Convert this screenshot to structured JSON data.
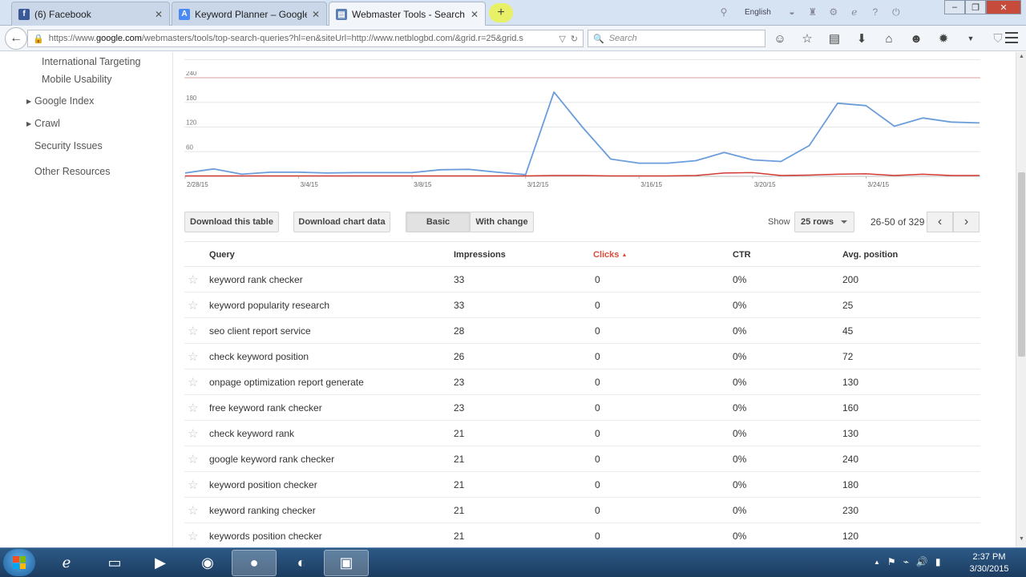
{
  "browser": {
    "tabs": [
      {
        "title": "(6) Facebook",
        "icon": "facebook-icon",
        "color": "#3b5998",
        "glyph": "f"
      },
      {
        "title": "Keyword Planner – Google ...",
        "icon": "google-adwords-icon",
        "color": "#4a8af4",
        "glyph": "A"
      },
      {
        "title": "Webmaster Tools - Search ...",
        "icon": "webmaster-tools-icon",
        "color": "#5b7fb5",
        "glyph": "▤"
      }
    ],
    "newtab_glyph": "+",
    "language": "English",
    "url_prefix": "https://www.",
    "url_domain": "google.com",
    "url_rest": "/webmasters/tools/top-search-queries?hl=en&siteUrl=http://www.netblogbd.com/&grid.r=25&grid.s",
    "search_placeholder": "Search"
  },
  "sidebar": {
    "sub_items": [
      "International Targeting",
      "Mobile Usability"
    ],
    "sections": [
      {
        "label": "Google Index",
        "expandable": true
      },
      {
        "label": "Crawl",
        "expandable": true
      },
      {
        "label": "Security Issues",
        "expandable": false
      },
      {
        "label": "Other Resources",
        "expandable": false
      }
    ]
  },
  "chart_data": {
    "type": "line",
    "title": "",
    "xlabel": "",
    "ylabel": "",
    "ylim": [
      0,
      240
    ],
    "yticks": [
      60,
      120,
      180,
      240
    ],
    "x": [
      "2/28/15",
      "3/1/15",
      "3/2/15",
      "3/3/15",
      "3/4/15",
      "3/5/15",
      "3/6/15",
      "3/7/15",
      "3/8/15",
      "3/9/15",
      "3/10/15",
      "3/11/15",
      "3/12/15",
      "3/13/15",
      "3/14/15",
      "3/15/15",
      "3/16/15",
      "3/17/15",
      "3/18/15",
      "3/19/15",
      "3/20/15",
      "3/21/15",
      "3/22/15",
      "3/23/15",
      "3/24/15",
      "3/25/15",
      "3/26/15",
      "3/27/15",
      "3/28/15"
    ],
    "xtick_labels": [
      "2/28/15",
      "3/4/15",
      "3/8/15",
      "3/12/15",
      "3/16/15",
      "3/20/15",
      "3/24/15"
    ],
    "series": [
      {
        "name": "Impressions",
        "color": "#6b9ddb",
        "values": [
          8,
          18,
          5,
          10,
          10,
          8,
          9,
          9,
          9,
          16,
          17,
          10,
          4,
          205,
          120,
          42,
          32,
          32,
          38,
          58,
          40,
          36,
          75,
          178,
          172,
          122,
          142,
          132,
          130
        ]
      },
      {
        "name": "Clicks",
        "color": "#d33a32",
        "values": [
          1,
          1,
          1,
          1,
          1,
          1,
          1,
          1,
          1,
          1,
          1,
          1,
          1,
          2,
          2,
          1,
          1,
          1,
          2,
          8,
          9,
          2,
          3,
          5,
          6,
          2,
          5,
          2,
          2
        ]
      }
    ]
  },
  "controls": {
    "download_table": "Download this table",
    "download_chart": "Download chart data",
    "view_basic": "Basic",
    "view_change": "With change",
    "show_label": "Show",
    "rows_value": "25 rows",
    "range_text": "26-50 of 329"
  },
  "table": {
    "columns": [
      "Query",
      "Impressions",
      "Clicks",
      "CTR",
      "Avg. position"
    ],
    "sort_arrow": "▲",
    "rows": [
      [
        "keyword rank checker",
        "33",
        "0",
        "0%",
        "200"
      ],
      [
        "keyword popularity research",
        "33",
        "0",
        "0%",
        "25"
      ],
      [
        "seo client report service",
        "28",
        "0",
        "0%",
        "45"
      ],
      [
        "check keyword position",
        "26",
        "0",
        "0%",
        "72"
      ],
      [
        "onpage optimization report generate",
        "23",
        "0",
        "0%",
        "130"
      ],
      [
        "free keyword rank checker",
        "23",
        "0",
        "0%",
        "160"
      ],
      [
        "check keyword rank",
        "21",
        "0",
        "0%",
        "130"
      ],
      [
        "google keyword rank checker",
        "21",
        "0",
        "0%",
        "240"
      ],
      [
        "keyword position checker",
        "21",
        "0",
        "0%",
        "180"
      ],
      [
        "keyword ranking checker",
        "21",
        "0",
        "0%",
        "230"
      ],
      [
        "keywords position checker",
        "21",
        "0",
        "0%",
        "120"
      ]
    ]
  },
  "taskbar": {
    "apps": [
      "ie-icon",
      "explorer-icon",
      "media-player-icon",
      "chrome-icon",
      "firefox-icon",
      "camtasia-icon",
      "window-icon"
    ],
    "time": "2:37 PM",
    "date": "3/30/2015"
  }
}
